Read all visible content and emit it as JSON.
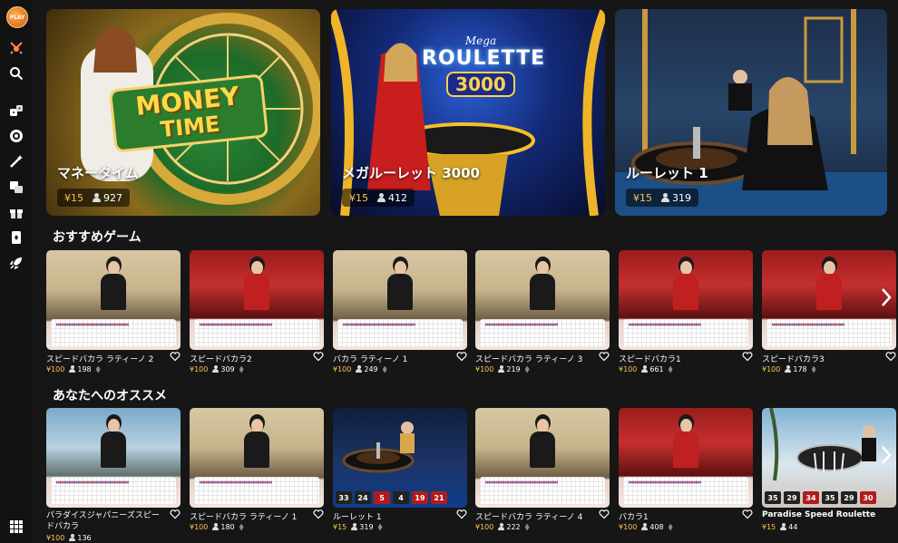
{
  "brand": {
    "logo_text": "PLAY",
    "accent": "#ffc34d"
  },
  "sidebar": {
    "icons": [
      "logo-icon",
      "swords-icon",
      "search-icon",
      "dice-icon",
      "roulette-icon",
      "magic-wand-icon",
      "slot-icon",
      "gift-box-icon",
      "card-icon",
      "rocket-icon"
    ],
    "bottom_icon": "grid-menu-icon"
  },
  "hero": [
    {
      "title": "マネータイム",
      "bet": "¥15",
      "players": "927",
      "logo_line1": "MONEY",
      "logo_line2": "TIME"
    },
    {
      "title": "メガルーレット 3000",
      "bet": "¥15",
      "players": "412",
      "logo_line1": "Mega",
      "logo_line2": "ROULETTE",
      "logo_line3": "3000"
    },
    {
      "title": "ルーレット 1",
      "bet": "¥15",
      "players": "319"
    }
  ],
  "sections": {
    "recommended": {
      "title": "おすすめゲーム",
      "cards": [
        {
          "name": "スピードバカラ ラティーノ 2",
          "bet": "¥100",
          "players": "198"
        },
        {
          "name": "スピードバカラ2",
          "bet": "¥100",
          "players": "309"
        },
        {
          "name": "バカラ ラティーノ 1",
          "bet": "¥100",
          "players": "249"
        },
        {
          "name": "スピードバカラ ラティーノ 3",
          "bet": "¥100",
          "players": "219"
        },
        {
          "name": "スピードバカラ1",
          "bet": "¥100",
          "players": "661"
        },
        {
          "name": "スピードバカラ3",
          "bet": "¥100",
          "players": "178"
        }
      ]
    },
    "for_you": {
      "title": "あなたへのオススメ",
      "cards": [
        {
          "name": "パラダイスジャパニーズスピードバカラ",
          "bet": "¥100",
          "players": "136"
        },
        {
          "name": "スピードバカラ ラティーノ 1",
          "bet": "¥100",
          "players": "180"
        },
        {
          "name": "ルーレット 1",
          "bet": "¥15",
          "players": "319",
          "numbers": [
            "33",
            "24",
            "5",
            "4",
            "19",
            "21"
          ]
        },
        {
          "name": "スピードバカラ ラティーノ 4",
          "bet": "¥100",
          "players": "222"
        },
        {
          "name": "バカラ1",
          "bet": "¥100",
          "players": "408"
        },
        {
          "name": "Paradise Speed Roulette",
          "bet": "¥15",
          "players": "44",
          "numbers": [
            "35",
            "29",
            "34",
            "35",
            "29",
            "30"
          ]
        }
      ]
    }
  }
}
